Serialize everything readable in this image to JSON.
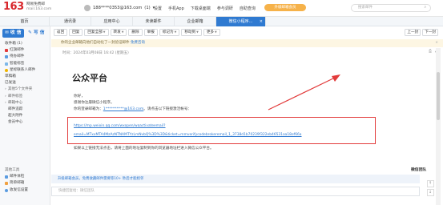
{
  "header": {
    "logo": "163",
    "logo_line1": "网易免费邮",
    "logo_line2": "mail.163.com",
    "account": "188****0353@163.com",
    "account_count": "(1)",
    "nav": [
      "设置",
      "手机App",
      "下载桌面端",
      "参与调研",
      "自助查询"
    ],
    "upgrade": "升级邮箱会员",
    "search_placeholder": "搜索邮件"
  },
  "tabs": [
    "首页",
    "通讯录",
    "应用中心",
    "未读邮件",
    "企业邮箱",
    "微信小程序..."
  ],
  "sidebar": {
    "receive": "收 信",
    "write": "写 信",
    "items": [
      {
        "label": "收件箱 (1)",
        "icon": "inbox-icon"
      },
      {
        "label": "红旗邮件",
        "icon": "flag-icon"
      },
      {
        "label": "待办邮件",
        "icon": "todo-icon"
      },
      {
        "label": "智能标签",
        "icon": "tag-icon"
      },
      {
        "label": "星标联系人邮件",
        "icon": "star-icon"
      },
      {
        "label": "草稿箱",
        "icon": ""
      },
      {
        "label": "已发送",
        "icon": ""
      },
      {
        "label": "其他5个文件夹",
        "icon": ""
      },
      {
        "label": "邮件标签",
        "icon": ""
      },
      {
        "label": "邮箱中心",
        "icon": ""
      },
      {
        "label": "邮件追踪",
        "icon": ""
      },
      {
        "label": "超大附件",
        "icon": ""
      },
      {
        "label": "会员中心",
        "icon": ""
      }
    ],
    "bottom": [
      {
        "label": "其他工具",
        "icon": ""
      },
      {
        "label": "邮件体检",
        "icon": "check-icon"
      },
      {
        "label": "简单邮箱",
        "icon": "mail-icon"
      },
      {
        "label": "收发信设置",
        "icon": "gear-icon"
      }
    ]
  },
  "toolbar": {
    "buttons": [
      "返回",
      "回复",
      "回复全部",
      "转发",
      "删除",
      "举报",
      "标记为",
      "移动到",
      "更多"
    ],
    "pager": [
      "上一封",
      "下一封"
    ]
  },
  "notice": {
    "text": "你的企业邮箱向他们自动化了一封验证邮件",
    "link": "免费咨询"
  },
  "message": {
    "meta": "时间：2024年03月08日 16:42 (星期五)",
    "subject": "公众平台",
    "greeting": "你好，",
    "line1": "感谢你注册微信小程序。",
    "line2_prefix": "你的登录邮箱为：",
    "email": "1**********@163.com",
    "line2_suffix": "。请点击以下链接激活帐号：",
    "url_line1": "https://mp.weixin.qq.com/wxopen/waactivateemail?",
    "url_line2": "email=MTxxMTA4MzAzNTNAMTYzLmNvbQ%3D%3D&ticket=mmverifycodebrokeremail_1_3738d1b70239f322eb46531aa18ef66a",
    "line3": "如果以上链接无法点击，请将上面的地址复制到你的浏览器地址栏进入微信公众平台。",
    "signature": "微信团队"
  },
  "reply": {
    "promo": "升级邮箱会员，免费收藏邮件需要等10+ 秒后才能相邻",
    "placeholder": "快捷回复给：微信团队"
  }
}
